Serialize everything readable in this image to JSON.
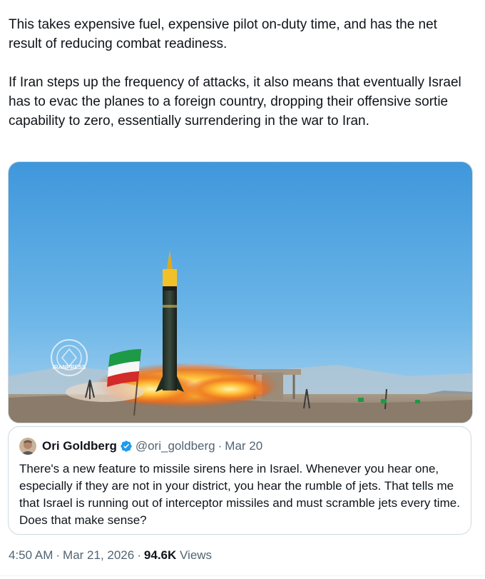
{
  "tweet": {
    "paragraphs": [
      "This takes expensive fuel, expensive pilot on-duty time, and has the net result of reducing combat readiness.",
      "If Iran steps up the frequency of attacks, it also means that eventually Israel has to evac the planes to a foreign country, dropping their offensive sortie capability to zero, essentially surrendering in the war to Iran."
    ],
    "media": {
      "watermark": "IRANPRESS"
    }
  },
  "quote": {
    "name": "Ori Goldberg",
    "handle": "@ori_goldberg",
    "separator": "·",
    "date": "Mar 20",
    "text": "There's a new feature to missile sirens here in Israel. Whenever you hear one, especially if they are not in your district, you hear the rumble of jets. That tells me that Israel is running out of interceptor missiles and must scramble jets every time. Does that make sense?",
    "verified_icon": "verified-badge-icon"
  },
  "meta": {
    "time": "4:50 AM",
    "date": "Mar 21, 2026",
    "separator": "·",
    "views_count": "94.6K",
    "views_label": "Views"
  },
  "colors": {
    "text": "#0f1419",
    "secondary": "#536471",
    "border": "#cfd9de",
    "verified": "#1d9bf0"
  }
}
